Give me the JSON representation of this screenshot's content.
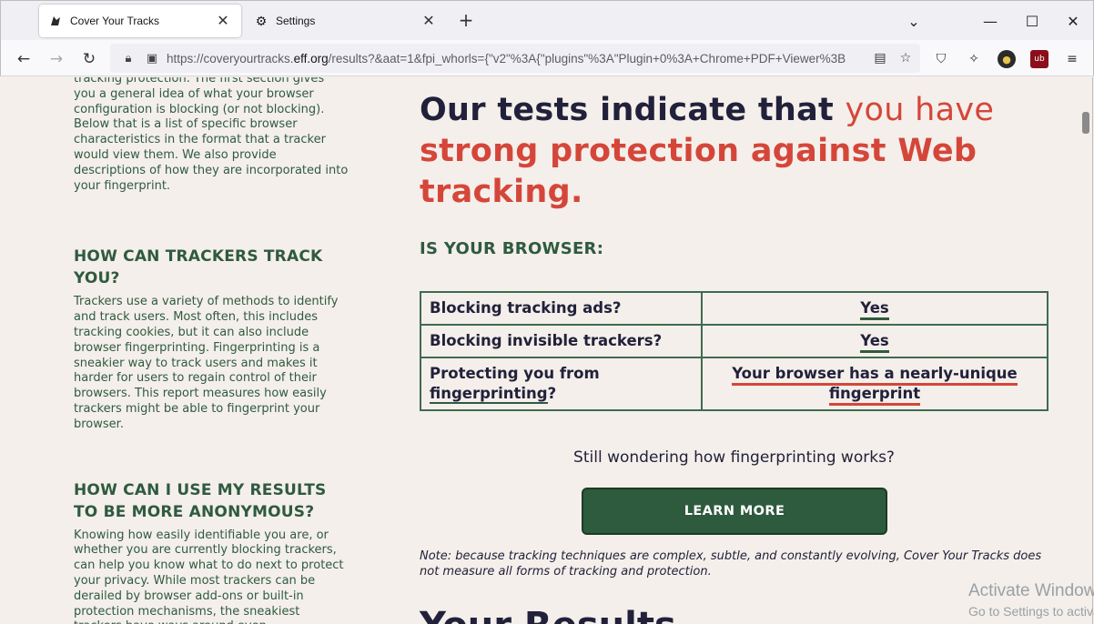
{
  "browser": {
    "tabs": [
      {
        "title": "Cover Your Tracks",
        "icon": "eff-favicon-icon",
        "active": true
      },
      {
        "title": "Settings",
        "icon": "gear-icon",
        "active": false
      }
    ],
    "new_tab": "+",
    "url_prefix": "https://coveryourtracks.",
    "url_domain": "eff.org",
    "url_suffix": "/results?&aat=1&fpi_whorls={\"v2\"%3A{\"plugins\"%3A\"Plugin+0%3A+Chrome+PDF+Viewer%3B",
    "window_controls": [
      "minimize",
      "maximize",
      "close"
    ]
  },
  "sidebar": {
    "intro": "tracking protection. The first section gives you a general idea of what your browser configuration is blocking (or not blocking). Below that is a list of specific browser characteristics in the format that a tracker would view them. We also provide descriptions of how they are incorporated into your fingerprint.",
    "section1_title": "HOW CAN TRACKERS TRACK YOU?",
    "section1_body": "Trackers use a variety of methods to identify and track users. Most often, this includes tracking cookies, but it can also include browser fingerprinting. Fingerprinting is a sneakier way to track users and makes it harder for users to regain control of their browsers. This report measures how easily trackers might be able to fingerprint your browser.",
    "section2_title": "HOW CAN I USE MY RESULTS TO BE MORE ANONYMOUS?",
    "section2_body": "Knowing how easily identifiable you are, or whether you are currently blocking trackers, can help you know what to do next to protect your privacy. While most trackers can be derailed by browser add-ons or built-in protection mechanisms, the sneakiest trackers have ways around even"
  },
  "main": {
    "headline_part1": "Our tests indicate that ",
    "headline_part2": "you have",
    "headline_part3": "strong protection against Web tracking",
    "headline_period": ".",
    "subhead": "IS YOUR BROWSER:",
    "rows": [
      {
        "question": "Blocking tracking ads?",
        "answer": "Yes"
      },
      {
        "question": "Blocking invisible trackers?",
        "answer": "Yes"
      }
    ],
    "row3_question_prefix": "Protecting you from ",
    "row3_question_link": "fingerprinting",
    "row3_question_suffix": "?",
    "row3_answer_line1": "Your browser has a nearly-unique",
    "row3_answer_line2": "fingerprint",
    "wonder": "Still wondering how fingerprinting works?",
    "learn_more": "LEARN MORE",
    "note": "Note: because tracking techniques are complex, subtle, and constantly evolving, Cover Your Tracks does not measure all forms of tracking and protection.",
    "your_results": "Your Results"
  },
  "watermark": {
    "line1": "Activate Windows",
    "line2": "Go to Settings to activate Windows."
  },
  "colors": {
    "page_bg": "#f4efea",
    "dark_green": "#2f5a3f",
    "accent_red": "#d5463a",
    "navy": "#22213b"
  }
}
